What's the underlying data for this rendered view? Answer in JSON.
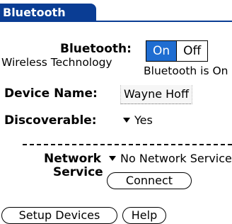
{
  "title": "Bluetooth",
  "bluetooth": {
    "label": "Bluetooth:",
    "sublabel": "Wireless Technology",
    "on_label": "On",
    "off_label": "Off",
    "selected": "On",
    "status": "Bluetooth is On"
  },
  "device_name": {
    "label": "Device Name:",
    "value": "Wayne Hoff"
  },
  "discoverable": {
    "label": "Discoverable:",
    "value": "Yes"
  },
  "network": {
    "label_line1": "Network",
    "label_line2": "Service",
    "value": "No Network Service",
    "connect_label": "Connect"
  },
  "buttons": {
    "setup_devices": "Setup Devices",
    "help": "Help"
  },
  "colors": {
    "title_bar": "#0a3d94",
    "selected": "#1f6dd1"
  }
}
